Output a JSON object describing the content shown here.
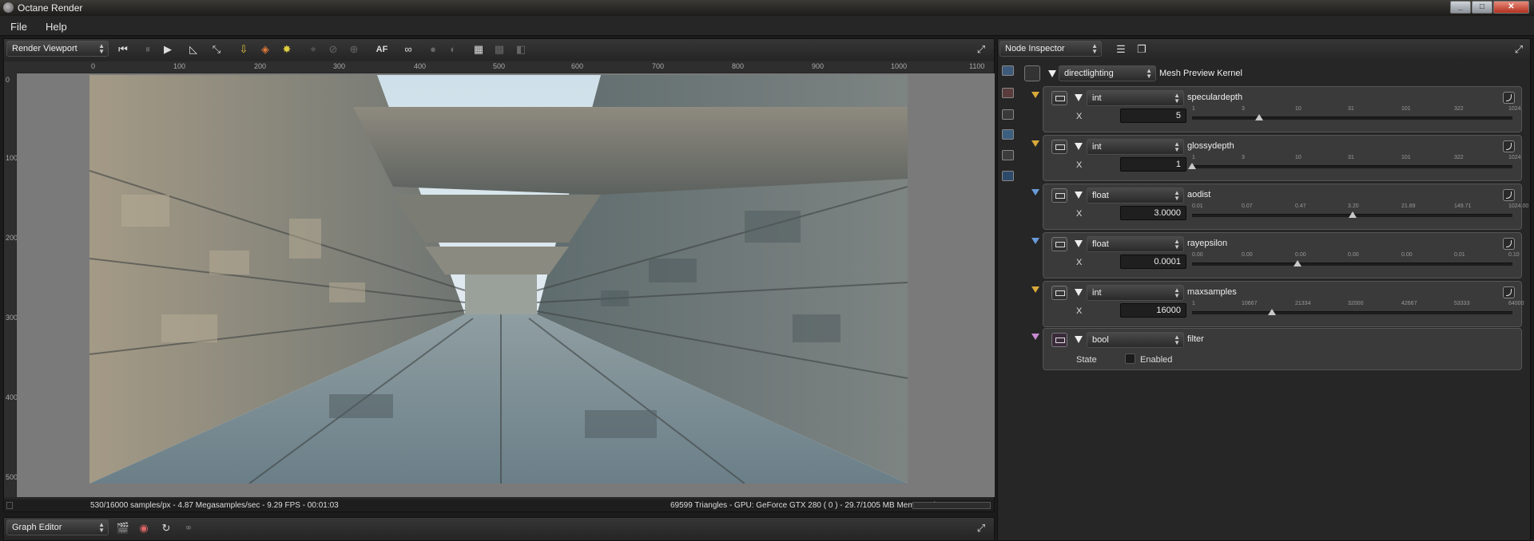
{
  "window": {
    "title": "Octane Render",
    "controls": [
      "_",
      "□",
      "✕"
    ]
  },
  "menu": [
    "File",
    "Help"
  ],
  "render_panel": {
    "selector": "Render Viewport",
    "toolbar_af": "AF",
    "ruler_x": [
      "0",
      "100",
      "200",
      "300",
      "400",
      "500",
      "600",
      "700",
      "800",
      "900",
      "1000",
      "1100"
    ],
    "ruler_y": [
      "0",
      "100",
      "200",
      "300",
      "400",
      "500"
    ],
    "status_left": "530/16000 samples/px - 4.87 Megasamples/sec - 9.29 FPS - 00:01:03",
    "status_right": "69599 Triangles - GPU: GeForce GTX 280 ( 0 ) - 29.7/1005 MB Mem Used"
  },
  "graph_editor": {
    "selector": "Graph Editor"
  },
  "inspector": {
    "selector": "Node Inspector",
    "kernel_type": "directlighting",
    "kernel_label": "Mesh Preview Kernel",
    "params": [
      {
        "type": "int",
        "name": "speculardepth",
        "axis": "X",
        "value": "5",
        "ticks": [
          "1",
          "3",
          "10",
          "31",
          "101",
          "322",
          "1024"
        ],
        "level": 0.21,
        "pin": "yellow"
      },
      {
        "type": "int",
        "name": "glossydepth",
        "axis": "X",
        "value": "1",
        "ticks": [
          "1",
          "3",
          "10",
          "31",
          "101",
          "322",
          "1024"
        ],
        "level": 0.0,
        "pin": "yellow"
      },
      {
        "type": "float",
        "name": "aodist",
        "axis": "X",
        "value": "3.0000",
        "ticks": [
          "0.01",
          "0.07",
          "0.47",
          "3.20",
          "21.89",
          "149.71",
          "1024.00"
        ],
        "level": 0.5,
        "pin": "blue"
      },
      {
        "type": "float",
        "name": "rayepsilon",
        "axis": "X",
        "value": "0.0001",
        "ticks": [
          "0.00",
          "0.00",
          "0.00",
          "0.00",
          "0.00",
          "0.01",
          "0.10"
        ],
        "level": 0.33,
        "pin": "blue"
      },
      {
        "type": "int",
        "name": "maxsamples",
        "axis": "X",
        "value": "16000",
        "ticks": [
          "1",
          "10667",
          "21334",
          "32000",
          "42667",
          "53333",
          "64000"
        ],
        "level": 0.25,
        "pin": "yellow"
      }
    ],
    "bool_param": {
      "type": "bool",
      "name": "filter",
      "label": "State",
      "checkbox_label": "Enabled",
      "checked": false,
      "pin": "pink"
    }
  },
  "colors": {
    "pin_yellow": "#d8a93a",
    "pin_blue": "#6a9ad8",
    "pin_pink": "#c98ad3",
    "panel_bg": "#262626"
  }
}
